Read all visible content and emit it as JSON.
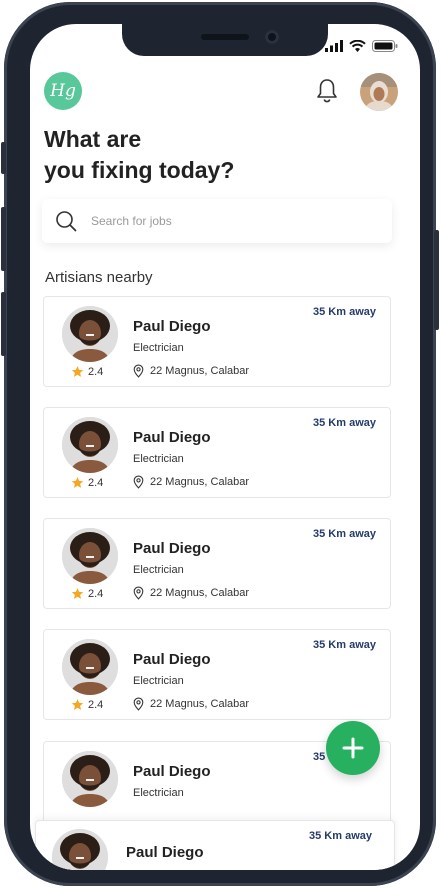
{
  "header": {
    "logo_text": "Hg",
    "headline_line1": "What are",
    "headline_line2": "you fixing today?"
  },
  "search": {
    "placeholder": "Search for jobs",
    "value": ""
  },
  "section_title": "Artisians nearby",
  "artisans": [
    {
      "name": "Paul Diego",
      "role": "Electrician",
      "rating": "2.4",
      "location": "22 Magnus, Calabar",
      "distance": "35 Km away"
    },
    {
      "name": "Paul Diego",
      "role": "Electrician",
      "rating": "2.4",
      "location": "22 Magnus, Calabar",
      "distance": "35 Km away"
    },
    {
      "name": "Paul Diego",
      "role": "Electrician",
      "rating": "2.4",
      "location": "22 Magnus, Calabar",
      "distance": "35 Km away"
    },
    {
      "name": "Paul Diego",
      "role": "Electrician",
      "rating": "2.4",
      "location": "22 Magnus, Calabar",
      "distance": "35 Km away"
    },
    {
      "name": "Paul Diego",
      "role": "Electrician",
      "rating": "",
      "location": "",
      "distance": "35 Km away"
    },
    {
      "name": "Paul Diego",
      "role": "",
      "rating": "",
      "location": "",
      "distance": "35 Km away"
    }
  ],
  "fab_icon": "plus-icon",
  "colors": {
    "brand": "#58c79a",
    "fab": "#27b060",
    "distance_text": "#243b6b",
    "star": "#f5a623"
  }
}
